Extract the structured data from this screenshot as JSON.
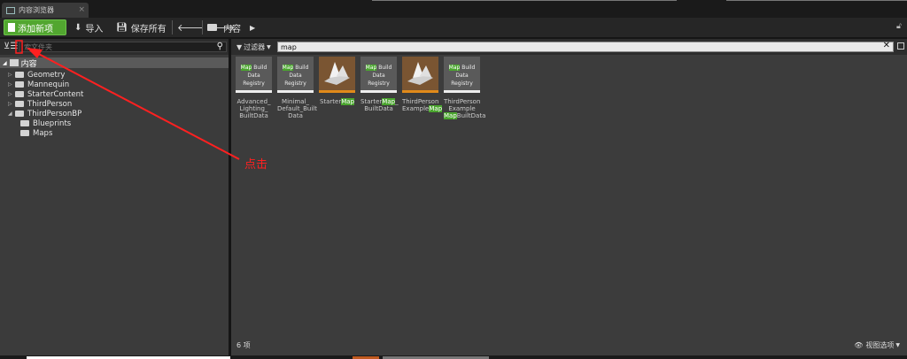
{
  "window": {
    "tab_title": "内容浏览器",
    "tab_close": "×"
  },
  "toolbar": {
    "add_new_label": "添加新项",
    "import_label": "导入",
    "save_all_label": "保存所有",
    "back_glyph": "🡐",
    "forward_glyph": "🡒",
    "breadcrumb": "内容",
    "lock_glyph": "🔓︎"
  },
  "sources": {
    "search_placeholder": "索文件夹",
    "root_label": "内容",
    "folders": [
      {
        "label": "Geometry",
        "expandable": true,
        "depth": 1
      },
      {
        "label": "Mannequin",
        "expandable": true,
        "depth": 1
      },
      {
        "label": "StarterContent",
        "expandable": true,
        "depth": 1
      },
      {
        "label": "ThirdPerson",
        "expandable": true,
        "depth": 1
      },
      {
        "label": "ThirdPersonBP",
        "expandable": true,
        "expanded": true,
        "depth": 1
      },
      {
        "label": "Blueprints",
        "expandable": false,
        "depth": 2
      },
      {
        "label": "Maps",
        "expandable": false,
        "depth": 2
      }
    ]
  },
  "assets": {
    "filter_label": "过滤器",
    "search_value": "map",
    "clear_glyph": "✕",
    "items": [
      {
        "type": "registry",
        "thumb_lines": [
          "Map",
          "Build",
          "Data",
          "Registry"
        ],
        "name_lines": [
          "Advanced_",
          "Lighting_",
          "BuiltData"
        ]
      },
      {
        "type": "registry",
        "thumb_lines": [
          "Map",
          "Build",
          "Data",
          "Registry"
        ],
        "name_lines": [
          "Minimal_",
          "Default_Built",
          "Data"
        ]
      },
      {
        "type": "map",
        "name_lines": [
          "Starter",
          "Map"
        ]
      },
      {
        "type": "registry",
        "thumb_lines": [
          "Map",
          "Build",
          "Data",
          "Registry"
        ],
        "name_lines": [
          "Starter",
          "Map",
          "_",
          "BuiltData"
        ]
      },
      {
        "type": "map",
        "name_lines": [
          "ThirdPerson",
          "Example",
          "Map"
        ]
      },
      {
        "type": "registry",
        "thumb_lines": [
          "Map",
          "Build",
          "Data",
          "Registry"
        ],
        "name_lines": [
          "ThirdPerson",
          "Example",
          "Map",
          "BuiltData"
        ]
      }
    ],
    "item_count": "6 项",
    "view_options": "视图选项",
    "highlight_color": "#4aa52e"
  },
  "annotation": {
    "text": "点击",
    "color": "#ff2020"
  }
}
